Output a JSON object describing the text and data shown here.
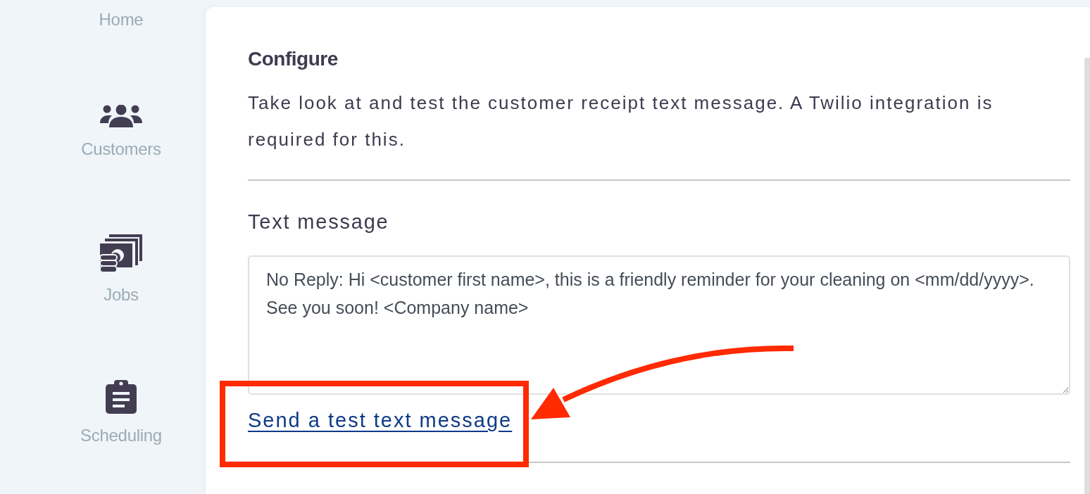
{
  "sidebar": {
    "items": [
      {
        "label": "Home"
      },
      {
        "label": "Customers"
      },
      {
        "label": "Jobs"
      },
      {
        "label": "Scheduling"
      }
    ]
  },
  "configure": {
    "title": "Configure",
    "description": "Take look at and test the customer receipt text message. A Twilio integration is required for this."
  },
  "text_message": {
    "label": "Text message",
    "value": "No Reply: Hi <customer first name>, this is a friendly reminder for your cleaning on <mm/dd/yyyy>. See you soon! <Company name>",
    "link": "Send a test text message"
  }
}
